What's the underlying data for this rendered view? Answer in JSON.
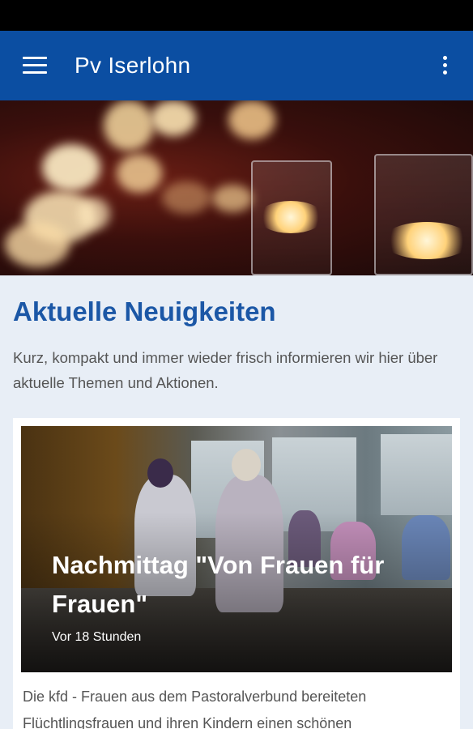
{
  "app": {
    "title": "Pv Iserlohn",
    "primary_color": "#0b4ea2",
    "menu_icon": "hamburger-menu-icon",
    "overflow_icon": "more-vert-icon"
  },
  "section": {
    "title": "Aktuelle Neuigkeiten",
    "description": "Kurz, kompakt und immer wieder frisch informieren wir hier über aktuelle Themen und Aktionen."
  },
  "news": [
    {
      "title": "Nachmittag \"Von Frauen für Frauen\"",
      "time": "Vor 18 Stunden",
      "excerpt": "Die kfd - Frauen aus dem Pastoralverbund bereiteten Flüchtlingsfrauen und ihren Kindern einen schönen"
    }
  ]
}
